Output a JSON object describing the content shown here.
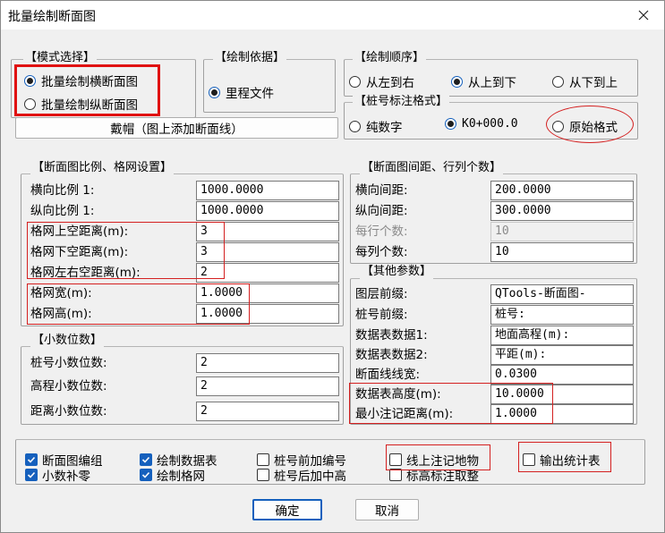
{
  "window": {
    "title": "批量绘制断面图",
    "close_icon": "close-icon"
  },
  "mode": {
    "legend": "【模式选择】",
    "options": [
      {
        "label": "批量绘制横断面图",
        "selected": true
      },
      {
        "label": "批量绘制纵断面图",
        "selected": false
      }
    ]
  },
  "basis": {
    "legend": "【绘制依据】",
    "options": [
      {
        "label": "里程文件",
        "selected": true
      }
    ]
  },
  "order": {
    "legend": "【绘制顺序】",
    "options": [
      {
        "label": "从左到右",
        "selected": false
      },
      {
        "label": "从上到下",
        "selected": true
      },
      {
        "label": "从下到上",
        "selected": false
      }
    ]
  },
  "stake_format": {
    "legend": "【桩号标注格式】",
    "options": [
      {
        "label": "纯数字",
        "selected": false
      },
      {
        "label": "K0+000.0",
        "selected": true
      },
      {
        "label": "原始格式",
        "selected": false
      }
    ]
  },
  "cap_button": {
    "label": "戴帽（图上添加断面线）"
  },
  "scale": {
    "legend": "【断面图比例、格网设置】",
    "rows": [
      {
        "label": "横向比例 1:",
        "value": "1000.0000"
      },
      {
        "label": "纵向比例 1:",
        "value": "1000.0000"
      },
      {
        "label": "格网上空距离(m):",
        "value": "3"
      },
      {
        "label": "格网下空距离(m):",
        "value": "3"
      },
      {
        "label": "格网左右空距离(m):",
        "value": "2"
      },
      {
        "label": "格网宽(m):",
        "value": "1.0000"
      },
      {
        "label": "格网高(m):",
        "value": "1.0000"
      }
    ]
  },
  "decimals": {
    "legend": "【小数位数】",
    "rows": [
      {
        "label": "桩号小数位数:",
        "value": "2"
      },
      {
        "label": "高程小数位数:",
        "value": "2"
      },
      {
        "label": "距离小数位数:",
        "value": "2"
      }
    ]
  },
  "spacing": {
    "legend": "【断面图间距、行列个数】",
    "rows": [
      {
        "label": "横向间距:",
        "value": "200.0000",
        "enabled": true
      },
      {
        "label": "纵向间距:",
        "value": "300.0000",
        "enabled": true
      },
      {
        "label": "每行个数:",
        "value": "10",
        "enabled": false
      },
      {
        "label": "每列个数:",
        "value": "10",
        "enabled": true
      }
    ]
  },
  "other": {
    "legend": "【其他参数】",
    "rows": [
      {
        "label": "图层前缀:",
        "value": "QTools-断面图-"
      },
      {
        "label": "桩号前缀:",
        "value": "桩号:"
      },
      {
        "label": "数据表数据1:",
        "value": "地面高程(m):"
      },
      {
        "label": "数据表数据2:",
        "value": "平距(m):"
      },
      {
        "label": "断面线线宽:",
        "value": "0.0300"
      },
      {
        "label": "数据表高度(m):",
        "value": "10.0000"
      },
      {
        "label": "最小注记距离(m):",
        "value": "1.0000"
      }
    ]
  },
  "checks": [
    {
      "label": "断面图编组",
      "checked": true
    },
    {
      "label": "小数补零",
      "checked": true
    },
    {
      "label": "绘制数据表",
      "checked": true
    },
    {
      "label": "绘制格网",
      "checked": true
    },
    {
      "label": "桩号前加编号",
      "checked": false
    },
    {
      "label": "桩号后加中高",
      "checked": false
    },
    {
      "label": "线上注记地物",
      "checked": false
    },
    {
      "label": "标高标注取整",
      "checked": false
    },
    {
      "label": "输出统计表",
      "checked": false
    }
  ],
  "buttons": {
    "ok": "确定",
    "cancel": "取消"
  },
  "colors": {
    "accent": "#1560bd",
    "highlight": "#d42020"
  }
}
